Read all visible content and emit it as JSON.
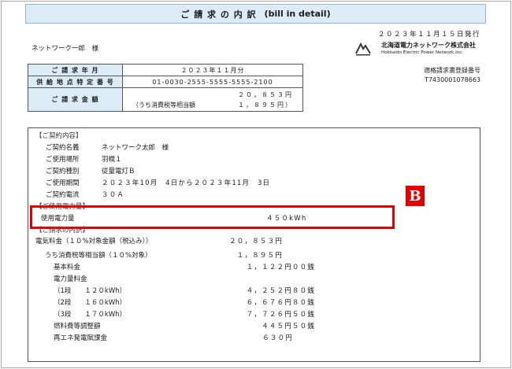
{
  "header": {
    "title_jp": "ご 請 求 の 内 訳",
    "title_en": "(bill in detail)",
    "issue_date": "２０２３年１１月１５日発行",
    "addressee": "ネットワーク一郎　様"
  },
  "company": {
    "name_jp": "北海道電力ネットワーク株式会社",
    "name_en": "Hokkaido Electric Power Network,Inc.",
    "reg_label": "適格請求書登録番号",
    "reg_number": "T7430001078663",
    "logo_color": "#3a3a3a"
  },
  "summary": {
    "year_month_label": "ご 請 求 年 月",
    "year_month_value": "２０２３年１１月分",
    "supply_point_label": "供 給 地 点 特 定 番 号",
    "supply_point_value": "01-0030-2555-5555-5555-2100",
    "amount_label": "ご 請 求 金 額",
    "amount_total": "２０，８５３円",
    "tax_label": "（うち消費税等相当額",
    "tax_value": "１，８９５円）"
  },
  "contract": {
    "section_title": "【ご契約内容】",
    "rows": [
      {
        "label": "ご契約名義",
        "value": "ネットワーク太郎　様"
      },
      {
        "label": "ご使用場所",
        "value": "羽幌１"
      },
      {
        "label": "ご契約種別",
        "value": "従量電灯Ｂ"
      },
      {
        "label": "ご使用期間",
        "value": "２０２３年10月　4日から２０２３年11月　3日"
      },
      {
        "label": "ご契約電流",
        "value": "３０Ａ"
      }
    ]
  },
  "usage": {
    "section_title": "【ご使用電力量】",
    "label": "使用電力量",
    "value": "４５０kWh"
  },
  "breakdown": {
    "section_title": "【ご請求の内訳】",
    "items": [
      {
        "label": "電気料金（１０%対象金額（税込み））",
        "value": "２０，８５３円"
      },
      {
        "label": "うち消費税等相当額（１０%対象）",
        "value": "１，８９５円"
      },
      {
        "label": "基本料金",
        "value": "１，１２２円００銭"
      },
      {
        "label": "電力量料金",
        "value": ""
      },
      {
        "label": "（1段　　１２０kWh）",
        "value": "４，２５２円８０銭"
      },
      {
        "label": "（2段　　１６０kWh）",
        "value": "６，６７６円８０銭"
      },
      {
        "label": "（3段　　１７０kWh）",
        "value": "７，７２６円５０銭"
      },
      {
        "label": "燃料費等調整額",
        "value": "４４５円５０銭"
      },
      {
        "label": "再エネ発電賦課金",
        "value": "６３０円"
      }
    ]
  },
  "annotation": {
    "marker": "B",
    "color": "#e10000"
  }
}
